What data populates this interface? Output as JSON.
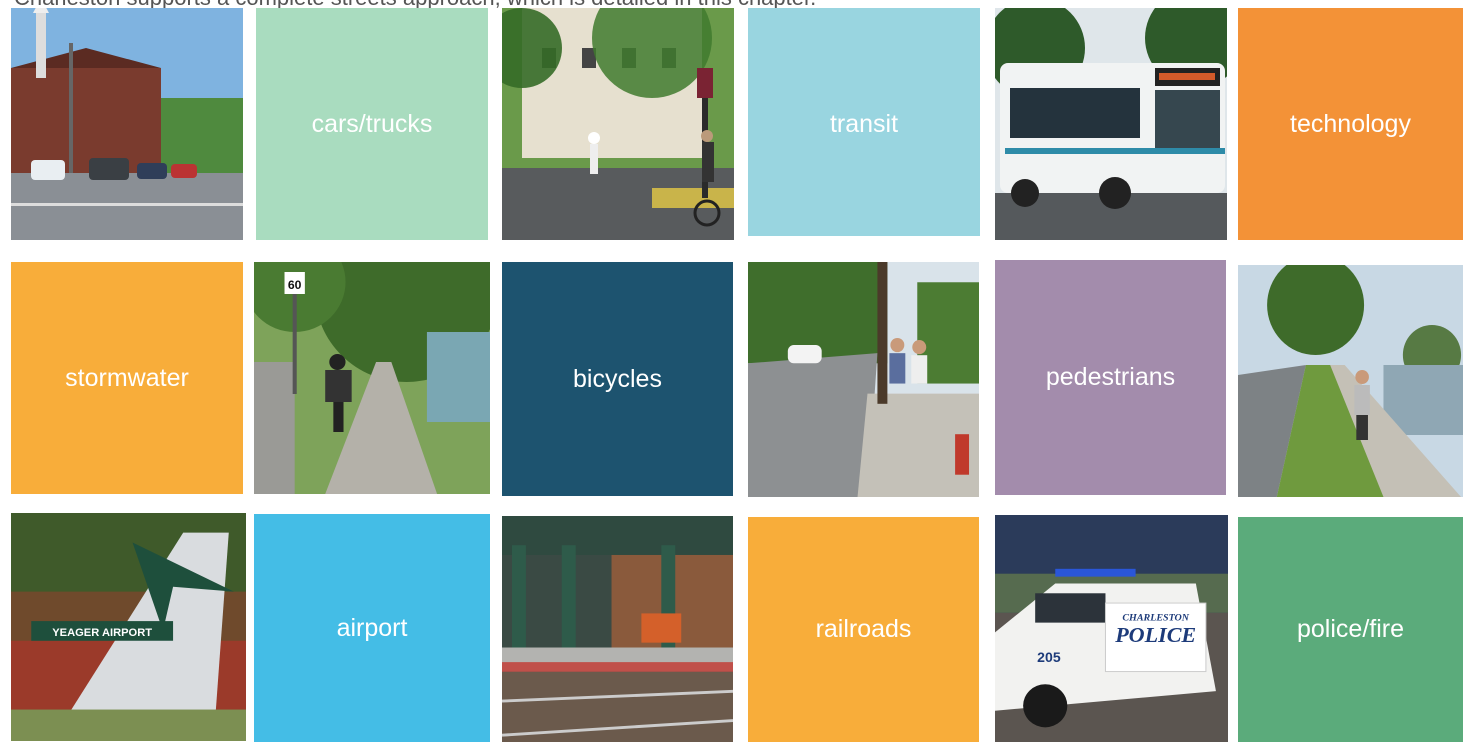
{
  "intro": "Charleston supports a complete streets approach, which is detailed in this chapter.",
  "labels": {
    "cars_trucks": "cars/trucks",
    "transit": "transit",
    "technology": "technology",
    "stormwater": "stormwater",
    "bicycles": "bicycles",
    "pedestrians": "pedestrians",
    "airport": "airport",
    "railroads": "railroads",
    "police_fire": "police/fire"
  },
  "photo_text": {
    "airport_sign": "YEAGER AIRPORT",
    "police_top": "CHARLESTON",
    "police_main": "POLICE",
    "police_number": "205",
    "route_sign": "60"
  },
  "colors": {
    "mint": "#a9dcbf",
    "light_blue": "#99d5e0",
    "orange": "#f39237",
    "yellow_orange": "#f8ad3a",
    "dark_teal": "#1d536f",
    "purple": "#a38cac",
    "sky_blue": "#44bde6",
    "green": "#5bab7b"
  }
}
